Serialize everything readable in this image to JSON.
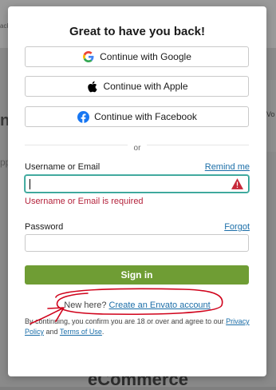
{
  "background": {
    "top_text": "ack",
    "left_text_1": "n",
    "left_text_2": "pp",
    "bottom_text": "eCommerce",
    "right_text": "Vo"
  },
  "modal": {
    "title": "Great to have you back!",
    "social": {
      "google": "Continue with Google",
      "apple": "Continue with Apple",
      "facebook": "Continue with Facebook"
    },
    "or_label": "or",
    "username": {
      "label": "Username or Email",
      "remind_link": "Remind me",
      "value": "",
      "error": "Username or Email is required"
    },
    "password": {
      "label": "Password",
      "forgot_link": "Forgot",
      "value": ""
    },
    "signin_label": "Sign in",
    "new_here": {
      "prefix": "New here?",
      "link": "Create an Envato account"
    },
    "terms": {
      "line1": "By continuing, you confirm you are 18 or over and agree to our",
      "privacy": "Privacy Policy",
      "and": "and",
      "terms_link": "Terms of Use",
      "period": "."
    }
  },
  "colors": {
    "primary_button": "#6f9d34",
    "link": "#1b6ea8",
    "error": "#b4233c",
    "annotation": "#d0021b"
  },
  "icons": [
    "google-icon",
    "apple-icon",
    "facebook-icon",
    "warning-icon"
  ]
}
